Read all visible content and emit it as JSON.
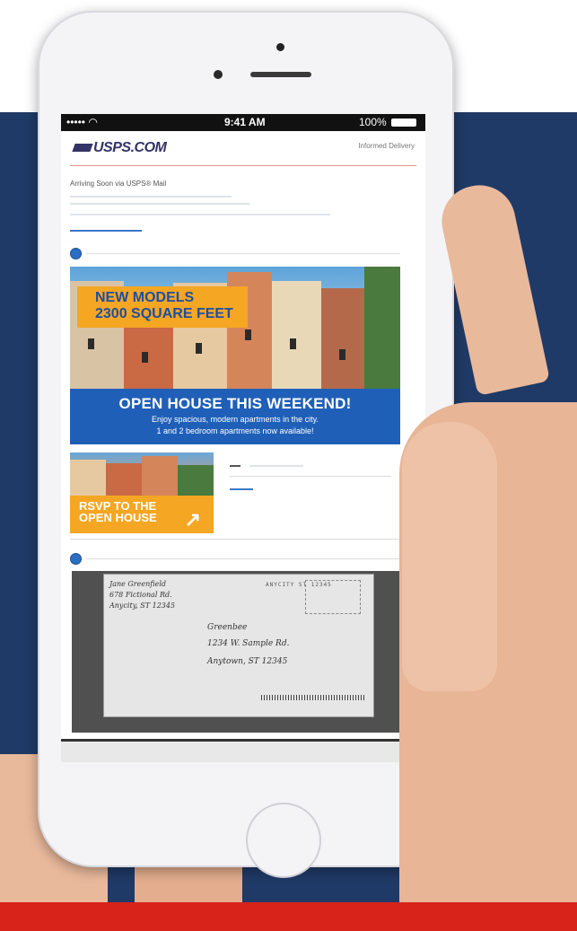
{
  "status_bar": {
    "carrier": "••••• ◠",
    "time": "9:41 AM",
    "battery": "100%"
  },
  "header": {
    "logo": "USPS.COM",
    "informed_delivery": "Informed Delivery"
  },
  "content": {
    "arriving": "Arriving Soon via USPS® Mail"
  },
  "ad": {
    "promo_line1": "NEW MODELS",
    "promo_line2": "2300 SQUARE FEET",
    "headline": "OPEN HOUSE THIS WEEKEND!",
    "sub_line1": "Enjoy spacious, modern apartments in the city.",
    "sub_line2": "1 and 2 bedroom apartments now available!"
  },
  "rsvp": {
    "line1": "RSVP TO THE",
    "line2": "OPEN HOUSE",
    "arrow": "↗"
  },
  "envelope": {
    "return_line1": "Jane Greenfield",
    "return_line2": "678 Fictional Rd.",
    "return_line3": "Anycity, ST 12345",
    "to_line1": "Greenbee",
    "to_line2": "1234 W. Sample Rd.",
    "to_line3": "Anytown, ST 12345",
    "postmark": "ANYCITY ST 12345"
  },
  "colors": {
    "navy": "#1f3a66",
    "red": "#d8231a",
    "orange": "#f5a623",
    "blue": "#1f5fb8"
  }
}
